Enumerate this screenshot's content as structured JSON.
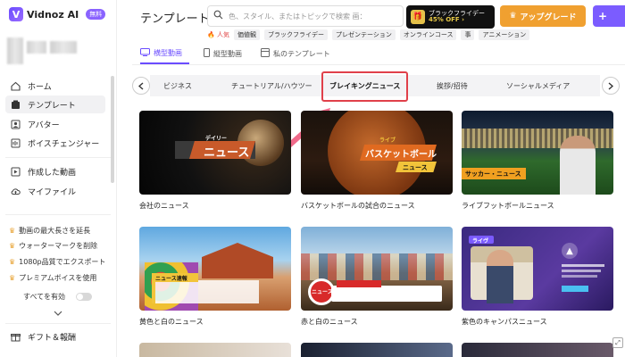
{
  "app": {
    "name": "Vidnoz AI",
    "badge": "無料"
  },
  "sidebar": {
    "nav": [
      {
        "label": "ホーム",
        "icon": "home-icon"
      },
      {
        "label": "テンプレート",
        "icon": "template-icon"
      },
      {
        "label": "アバター",
        "icon": "avatar-icon"
      },
      {
        "label": "ボイスチェンジャー",
        "icon": "voice-icon"
      },
      {
        "label": "作成した動画",
        "icon": "video-icon"
      },
      {
        "label": "マイファイル",
        "icon": "cloud-icon"
      }
    ],
    "promos": [
      "動画の最大長さを延長",
      "ウォーターマークを削除",
      "1080p品質でエクスポート",
      "プレミアムボイスを使用"
    ],
    "enable_all": "すべてを有効",
    "gift": "ギフト＆報酬"
  },
  "header": {
    "title": "テンプレート",
    "search_placeholder": "色、スタイル、またはトピックで検索 画：",
    "bf_line1": "ブラックフライデー",
    "bf_line2": "45% OFF ›",
    "upgrade": "アップグレード",
    "plus": "+"
  },
  "popular": {
    "label": "人気",
    "tags": [
      "価値観",
      "ブラックフライデー",
      "プレゼンテーション",
      "オンラインコース",
      "事",
      "アニメーション"
    ]
  },
  "view_tabs": [
    "横型動画",
    "縦型動画",
    "私のテンプレート"
  ],
  "categories": [
    "ビジネス",
    "チュートリアル/ハウツー",
    "ブレイキングニュース",
    "挨拶/招待",
    "ソーシャルメディア"
  ],
  "selected_category": "ブレイキングニュース",
  "cards": [
    {
      "label": "会社のニュース",
      "overlay": "ニュース",
      "kicker": "デイリー"
    },
    {
      "label": "バスケットボールの試合のニュース",
      "overlay": "バスケットボール",
      "overlay2": "ニュース",
      "kicker": "ライブ"
    },
    {
      "label": "ライブフットボールニュース",
      "overlay": "サッカー・ニュース"
    },
    {
      "label": "黄色と白のニュース",
      "overlay": "ニュース速報"
    },
    {
      "label": "赤と白のニュース",
      "overlay": "ニュース"
    },
    {
      "label": "紫色のキャンパスニュース",
      "overlay": "ライヴ"
    }
  ],
  "colors": {
    "accent": "#6a4cff",
    "upgrade": "#f0a030",
    "highlight": "#e0404a"
  }
}
